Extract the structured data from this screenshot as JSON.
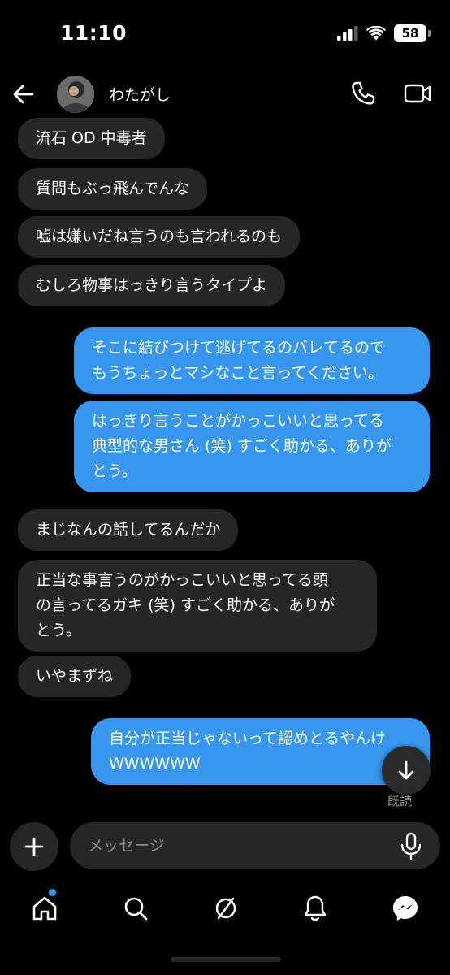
{
  "status_bar": {
    "time": "11:10",
    "battery": "58"
  },
  "header": {
    "contact_name": "わたがし"
  },
  "messages": [
    {
      "direction": "incoming",
      "lines": [
        "流石 OD 中毒者"
      ]
    },
    {
      "direction": "incoming",
      "lines": [
        "質問もぶっ飛んでんな"
      ]
    },
    {
      "direction": "incoming",
      "lines": [
        "嘘は嫌いだね言うのも言われるのも"
      ]
    },
    {
      "direction": "incoming",
      "lines": [
        "むしろ物事はっきり言うタイプよ"
      ]
    },
    {
      "direction": "outgoing",
      "lines": [
        "そこに結びつけて逃げてるのバレてるので",
        "もうちょっとマシなこと言ってください。"
      ]
    },
    {
      "direction": "outgoing",
      "lines": [
        "はっきり言うことがかっこいいと思ってる",
        "典型的な男さん (笑) すごく助かる、ありが",
        "とう。"
      ]
    },
    {
      "direction": "incoming",
      "lines": [
        "まじなんの話してるんだか"
      ]
    },
    {
      "direction": "incoming",
      "lines": [
        "正当な事言うのがかっこいいと思ってる頭",
        "の言ってるガキ (笑) すごく助かる、ありが",
        "とう。"
      ]
    },
    {
      "direction": "incoming",
      "lines": [
        "いやまずね"
      ]
    },
    {
      "direction": "outgoing",
      "lines": [
        "自分が正当じゃないって認めとるやんけ",
        "WWWWWW"
      ]
    }
  ],
  "read_receipt": "既読",
  "composer": {
    "placeholder": "メッセージ"
  },
  "colors": {
    "background": "#000000",
    "incoming_bubble": "#262626",
    "outgoing_bubble": "#3797f0",
    "notification_dot": "#3797f0"
  },
  "icons": {
    "back": "arrow-left-icon",
    "call": "phone-icon",
    "video": "video-camera-icon",
    "scroll_down": "arrow-down-icon",
    "add": "plus-icon",
    "mic": "microphone-icon",
    "nav": [
      "home-icon",
      "search-icon",
      "explore-icon",
      "bell-icon",
      "messenger-icon"
    ]
  }
}
